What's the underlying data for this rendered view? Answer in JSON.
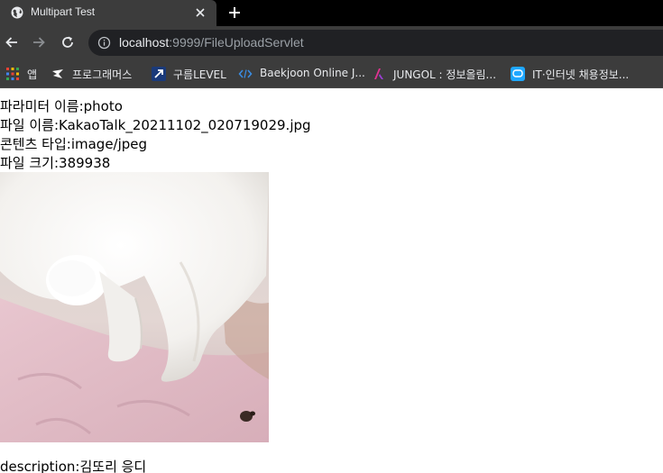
{
  "tab": {
    "title": "Multipart Test",
    "favicon": "globe-icon"
  },
  "address": {
    "host": "localhost",
    "path": ":9999/FileUploadServlet"
  },
  "bookmarks": [
    {
      "label": "앱",
      "icon": "apps-grid-icon"
    },
    {
      "label": "프로그래머스",
      "icon": "programmers-icon"
    },
    {
      "label": "구름LEVEL",
      "icon": "goorm-icon"
    },
    {
      "label": "Baekjoon Online J...",
      "icon": "code-icon"
    },
    {
      "label": "JUNGOL : 정보올림...",
      "icon": "jungol-icon"
    },
    {
      "label": "IT·인터넷 채용정보...",
      "icon": "chat-icon"
    }
  ],
  "upload": {
    "param_label": "파라미터 이름:",
    "param_value": "photo",
    "filename_label": "파일 이름:",
    "filename_value": "KakaoTalk_20211102_020719029.jpg",
    "content_type_label": "콘텐츠 타입:",
    "content_type_value": "image/jpeg",
    "size_label": "파일 크기:",
    "size_value": "389938",
    "description_label": "description:",
    "description_value": "김또리 응디"
  },
  "colors": {
    "chrome": "#3c3c3c",
    "tabstrip": "#000000",
    "omnibox": "#202124",
    "text_light": "#e8eaed"
  }
}
